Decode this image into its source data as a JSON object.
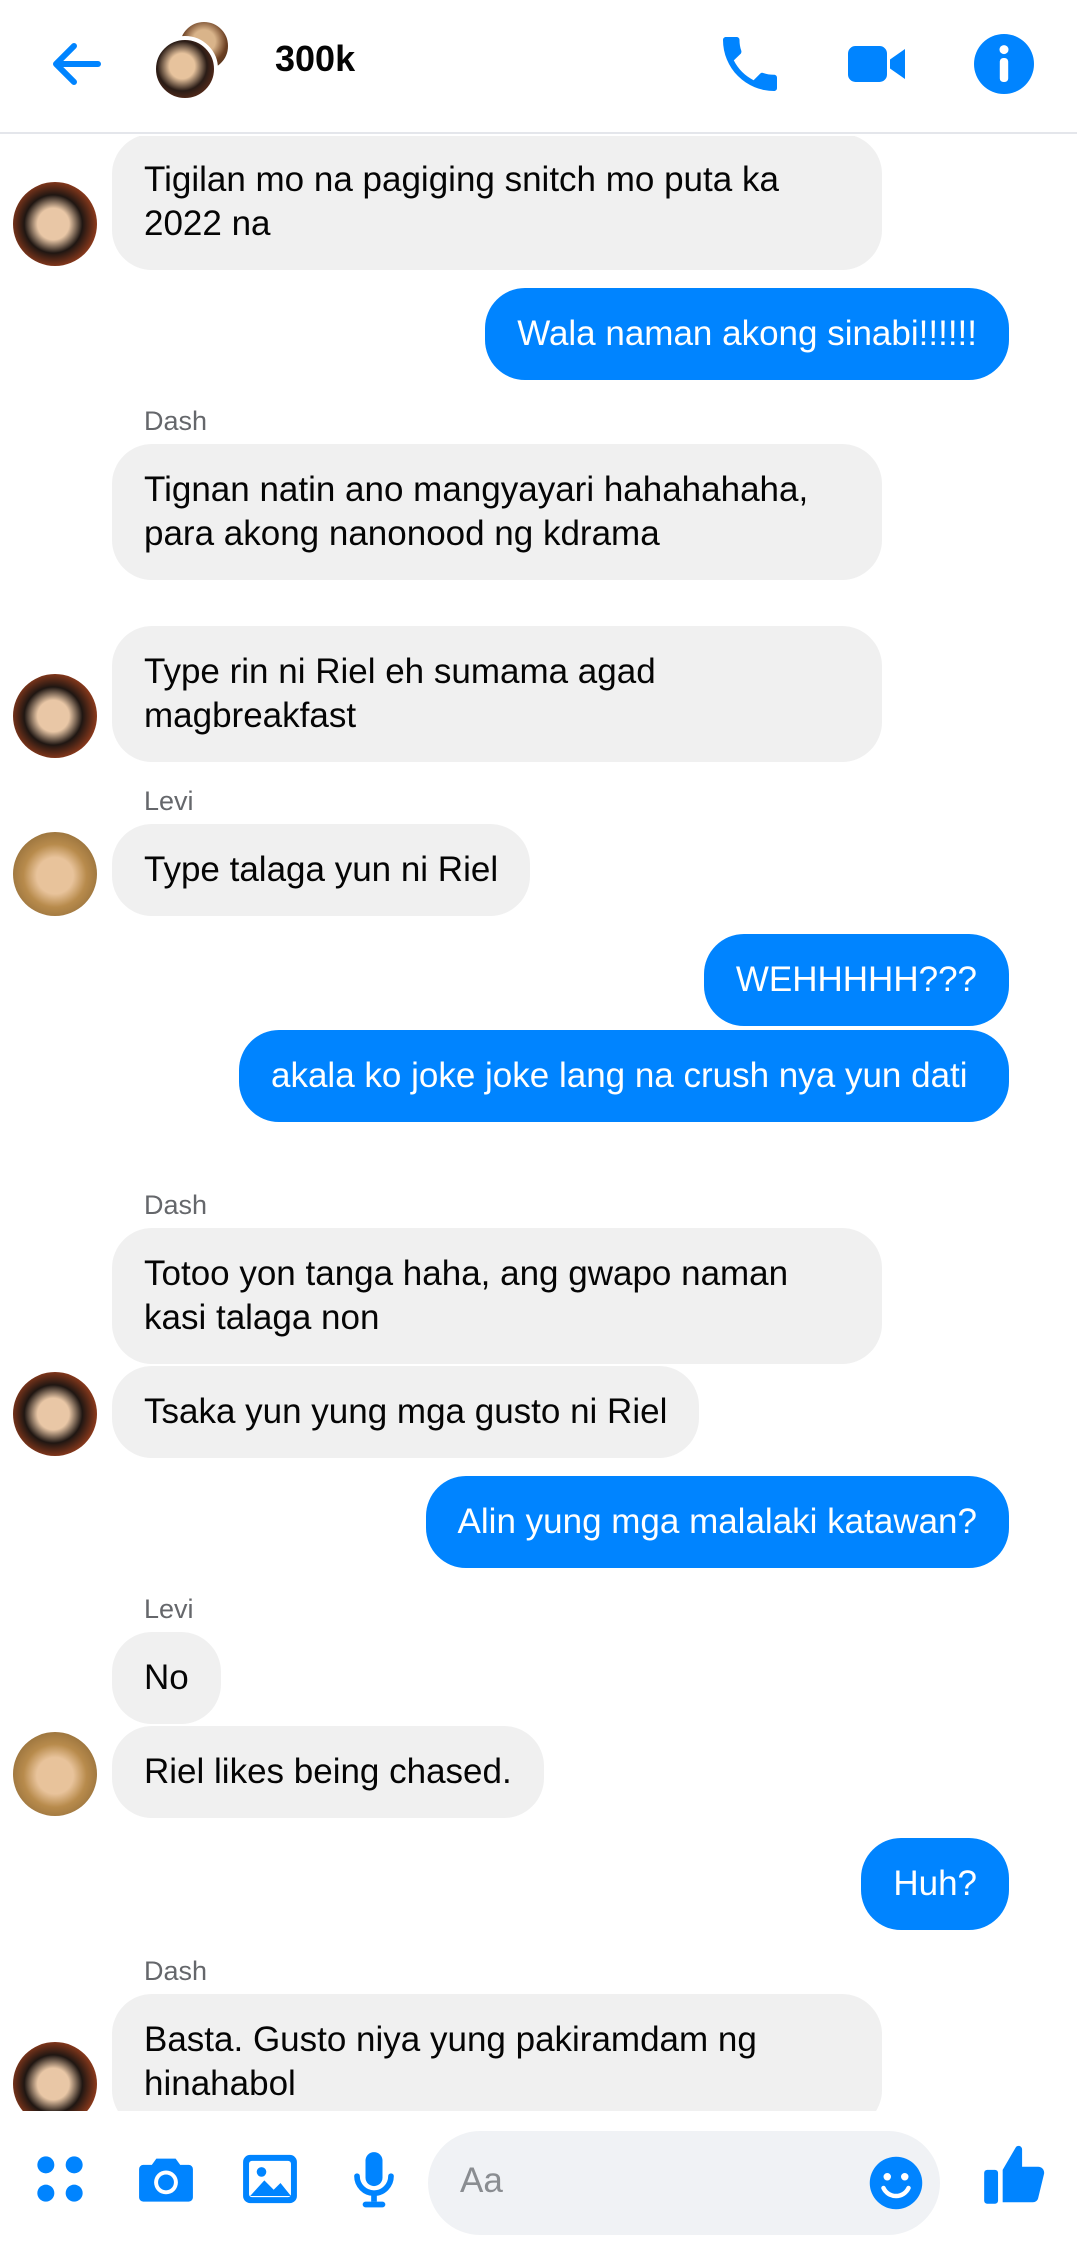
{
  "header": {
    "title": "300k",
    "icons": [
      "back-arrow-icon",
      "phone-icon",
      "video-camera-icon",
      "info-icon"
    ],
    "accent": "#0084ff"
  },
  "messages": [
    {
      "dir": "in",
      "text": "Tigilan mo na pagiging snitch mo puta ka 2022 na"
    },
    {
      "dir": "out",
      "text": "Wala naman akong sinabi!!!!!!"
    },
    {
      "sender": "Dash"
    },
    {
      "dir": "in",
      "text": "Tignan natin ano mangyayari hahahahaha, para akong nanonood ng kdrama"
    },
    {
      "dir": "in",
      "text": "Type rin ni Riel eh sumama agad magbreakfast"
    },
    {
      "sender": "Levi"
    },
    {
      "dir": "in",
      "text": "Type talaga yun ni Riel"
    },
    {
      "dir": "out",
      "text": "WEHHHHH???"
    },
    {
      "dir": "out",
      "text": "akala ko joke joke lang na crush nya yun dati"
    },
    {
      "sender": "Dash"
    },
    {
      "dir": "in",
      "text": "Totoo yon tanga haha, ang gwapo naman kasi talaga non"
    },
    {
      "dir": "in",
      "text": "Tsaka yun yung mga gusto ni Riel"
    },
    {
      "dir": "out",
      "text": "Alin yung mga malalaki katawan?"
    },
    {
      "sender": "Levi"
    },
    {
      "dir": "in",
      "text": "No"
    },
    {
      "dir": "in",
      "text": "Riel likes being chased."
    },
    {
      "dir": "out",
      "text": "Huh?"
    },
    {
      "sender": "Dash"
    },
    {
      "dir": "in",
      "text": "Basta. Gusto niya yung pakiramdam ng hinahabol"
    }
  ],
  "composer": {
    "placeholder": "Aa",
    "icons": [
      "apps-icon",
      "camera-icon",
      "photo-icon",
      "microphone-icon",
      "emoji-icon",
      "thumbs-up-icon"
    ]
  },
  "colors": {
    "incoming_bubble": "#f0f0f0",
    "outgoing_bubble": "#0084ff",
    "sender_text": "#65676b"
  }
}
